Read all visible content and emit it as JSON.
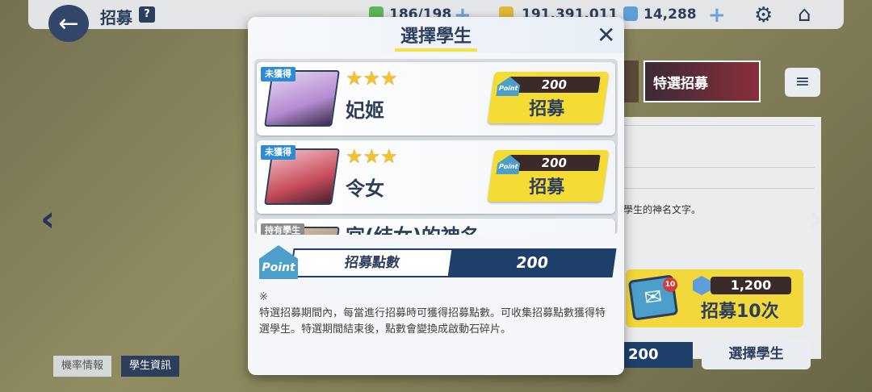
{
  "header": {
    "title": "招募",
    "help_icon": "?",
    "ap": "186/198",
    "credits": "191,391,011",
    "gems": "14,288"
  },
  "background": {
    "banner_label": "特選招募",
    "description_snippet": "學生的神名文字。",
    "recruit10_cost": "1,200",
    "recruit10_label": "招募10次",
    "mail_badge": "10",
    "points_value": "200",
    "select_student_label": "選擇學生",
    "tabs": [
      "機率情報",
      "學生資訊"
    ]
  },
  "modal": {
    "title": "選擇學生",
    "students": [
      {
        "tag": "未獲得",
        "name": "妃姬",
        "stars": "★★★",
        "cost": "200",
        "button_label": "招募"
      },
      {
        "tag": "未獲得",
        "name": "令女",
        "stars": "★★★",
        "cost": "200",
        "button_label": "招募"
      },
      {
        "tag": "持有學生",
        "name": "宮(结女)的神名",
        "stars": "",
        "cost": "",
        "button_label": ""
      }
    ],
    "point_icon_text": "Point",
    "points_label": "招募點數",
    "points_value": "200",
    "note_mark": "※",
    "note_text": "特選招募期間內，每當進行招募時可獲得招募點數。可收集招募點數獲得特選學生。特選期間結束後，點數會變換成啟動石碎片。"
  }
}
